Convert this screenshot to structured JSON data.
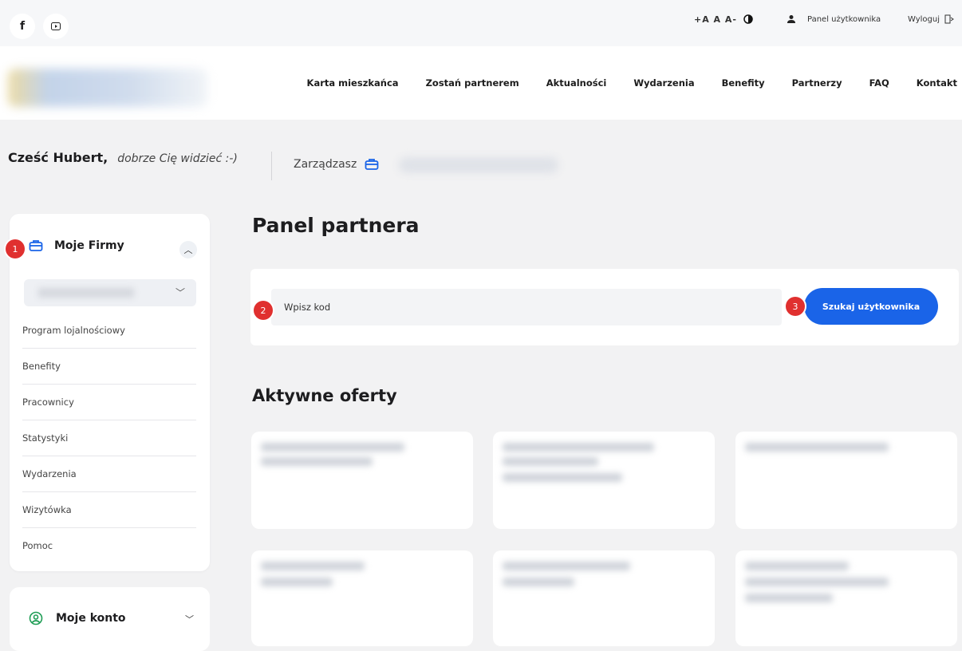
{
  "topbar": {
    "font_sizes": "+A A A-",
    "user_panel": "Panel użytkownika",
    "logout": "Wyloguj"
  },
  "nav": {
    "items": [
      "Karta mieszkańca",
      "Zostań partnerem",
      "Aktualności",
      "Wydarzenia",
      "Benefity",
      "Partnerzy",
      "FAQ",
      "Kontakt"
    ]
  },
  "greeting": {
    "name": "Cześć Hubert,",
    "subtitle": "dobrze Cię widzieć :-)"
  },
  "manage_label": "Zarządzasz",
  "sidebar": {
    "companies_title": "Moje Firmy",
    "menu": [
      "Program lojalnościowy",
      "Benefity",
      "Pracownicy",
      "Statystyki",
      "Wydarzenia",
      "Wizytówka",
      "Pomoc"
    ],
    "account_title": "Moje konto"
  },
  "main": {
    "panel_title": "Panel partnera",
    "search_placeholder": "Wpisz kod",
    "search_button": "Szukaj użytkownika",
    "offers_title": "Aktywne oferty"
  },
  "markers": [
    "1",
    "2",
    "3"
  ],
  "colors": {
    "accent": "#1a64e8",
    "marker": "#e0302f",
    "background": "#f2f2f3"
  }
}
